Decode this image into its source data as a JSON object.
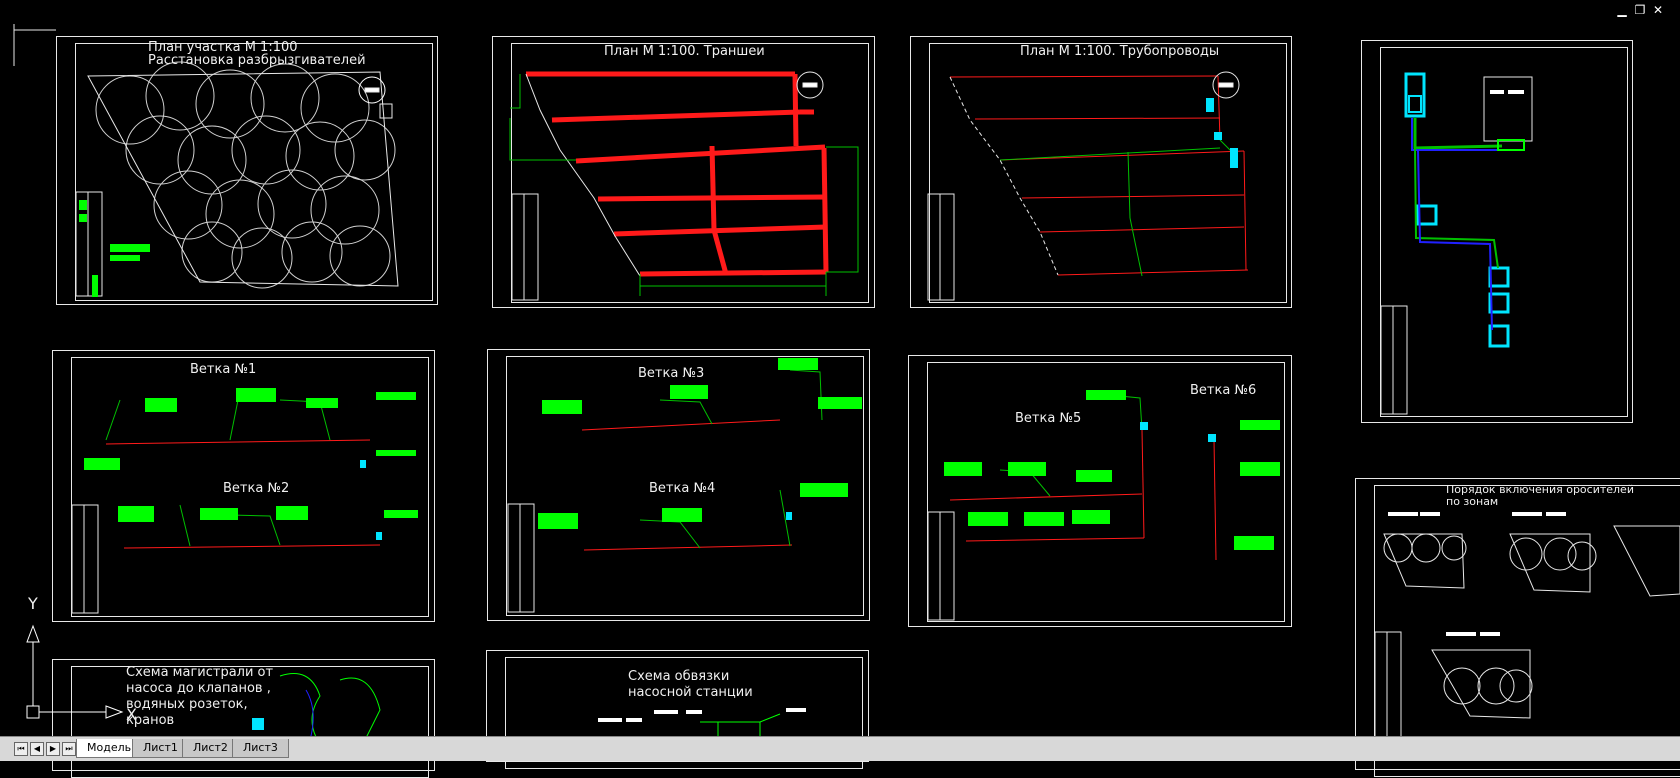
{
  "window": {
    "minimize": "▁",
    "restore": "❐",
    "close": "✕"
  },
  "sheets": {
    "s1": {
      "title1": "План участка М 1:100",
      "title2": "Расстановка разбрызгивателей"
    },
    "s2": {
      "title": "План  М 1:100. Траншеи"
    },
    "s3": {
      "title": "План  М 1:100. Трубопроводы"
    },
    "s5": {
      "title1": "Ветка №1",
      "title2": "Ветка №2"
    },
    "s6": {
      "title1": "Ветка №3",
      "title2": "Ветка №4"
    },
    "s7": {
      "title1": "Ветка №5",
      "title2": "Ветка №6"
    },
    "s8": {
      "title1": "Порядок включения оросителей",
      "title2": "по зонам"
    },
    "s9": {
      "line1": "Схема магистрали от",
      "line2": "насоса до клапанов ,",
      "line3": "водяных розеток,",
      "line4": "кранов"
    },
    "s10": {
      "line1": "Схема обвязки",
      "line2": "насосной станции"
    }
  },
  "ucs": {
    "y_label": "Y",
    "x_label": "X"
  },
  "tabs": [
    {
      "label": "Модель",
      "active": true
    },
    {
      "label": "Лист1",
      "active": false
    },
    {
      "label": "Лист2",
      "active": false
    },
    {
      "label": "Лист3",
      "active": false
    }
  ],
  "colors": {
    "background": "#000000",
    "frame": "#e8e8e8",
    "trench": "#ff1a1a",
    "label": "#00ff00",
    "pipe": "#00c000",
    "accent": "#00e5ff",
    "blue": "#2020ff"
  }
}
